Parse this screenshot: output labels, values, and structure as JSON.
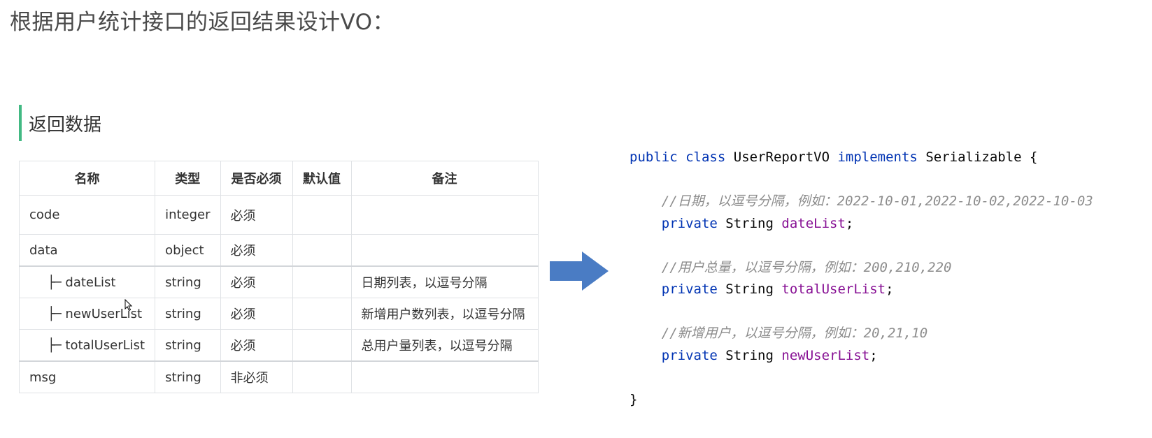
{
  "page": {
    "title": "根据用户统计接口的返回结果设计VO："
  },
  "section": {
    "title": "返回数据"
  },
  "table": {
    "headers": [
      "名称",
      "类型",
      "是否必须",
      "默认值",
      "备注"
    ],
    "rows": [
      {
        "name": "code",
        "prefix": "",
        "type": "integer",
        "required": "必须",
        "default": "",
        "note": ""
      },
      {
        "name": "data",
        "prefix": "",
        "type": "object",
        "required": "必须",
        "default": "",
        "note": ""
      },
      {
        "name": "dateList",
        "prefix": "├─",
        "type": "string",
        "required": "必须",
        "default": "",
        "note": "日期列表，以逗号分隔"
      },
      {
        "name": "newUserList",
        "prefix": "├─",
        "type": "string",
        "required": "必须",
        "default": "",
        "note": "新增用户数列表，以逗号分隔"
      },
      {
        "name": "totalUserList",
        "prefix": "├─",
        "type": "string",
        "required": "必须",
        "default": "",
        "note": "总用户量列表，以逗号分隔"
      },
      {
        "name": "msg",
        "prefix": "",
        "type": "string",
        "required": "非必须",
        "default": "",
        "note": ""
      }
    ]
  },
  "arrow": {
    "color": "#4a7cc4"
  },
  "code": {
    "line1": {
      "kw1": "public",
      "kw2": "class",
      "name": "UserReportVO",
      "kw3": "implements",
      "iface": "Serializable {"
    },
    "comment1": "//日期，以逗号分隔，例如：2022-10-01,2022-10-02,2022-10-03",
    "field1": {
      "kw": "private",
      "type": "String",
      "name": "dateList",
      "end": ";"
    },
    "comment2": "//用户总量，以逗号分隔，例如：200,210,220",
    "field2": {
      "kw": "private",
      "type": "String",
      "name": "totalUserList",
      "end": ";"
    },
    "comment3": "//新增用户，以逗号分隔，例如：20,21,10",
    "field3": {
      "kw": "private",
      "type": "String",
      "name": "newUserList",
      "end": ";"
    },
    "close": "}"
  }
}
